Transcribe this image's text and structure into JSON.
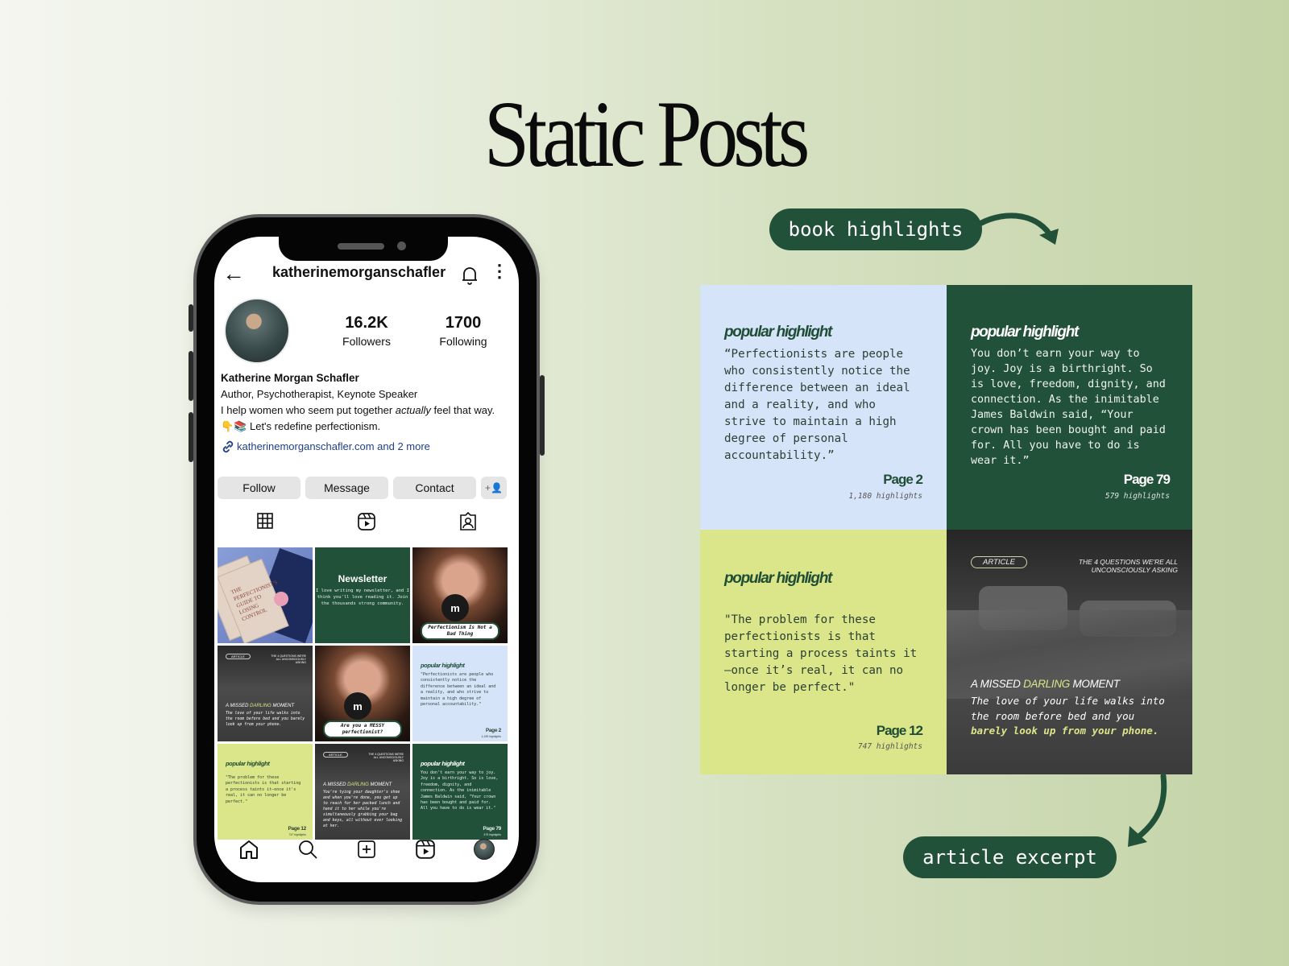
{
  "page": {
    "title": "Static Posts",
    "colors": {
      "brand_green": "#22513a",
      "light_blue": "#d6e4fa",
      "lime": "#dbe589",
      "charcoal": "#3d3d3d",
      "background_start": "#f4f6ef",
      "background_end": "#c3d3a6"
    }
  },
  "phone": {
    "header": {
      "back_icon": "arrow-left-icon",
      "username": "katherinemorganschafler",
      "bell_icon": "bell-icon",
      "more_icon": "more-vertical-icon"
    },
    "stats": [
      {
        "value": "16.2K",
        "label": "Followers"
      },
      {
        "value": "1700",
        "label": "Following"
      }
    ],
    "bio": {
      "name": "Katherine Morgan Schafler",
      "line1": "Author, Psychotherapist, Keynote Speaker",
      "line2_pre": "I help women who seem put together ",
      "line2_em": "actually",
      "line2_post": " feel that way.",
      "line3_emoji": "👇📚",
      "line3": " Let's redefine perfectionism.",
      "link": "katherinemorganschafler.com and 2 more"
    },
    "actions": {
      "follow": "Follow",
      "message": "Message",
      "contact": "Contact",
      "add_user_icon": "+👤"
    },
    "tabs": [
      "grid-icon",
      "reels-icon",
      "tagged-icon"
    ],
    "grid": {
      "book": {
        "lines": "THE PERFECTIONIST'S GUIDE TO LOSING CONTROL"
      },
      "newsletter": {
        "title": "Newsletter",
        "text": "I love writing my newsletter, and I think you'll love reading it. Join the thousands strong community."
      },
      "podcast1": {
        "mic_letter": "m",
        "caption": "Perfectionism Is Not a Bad Thing"
      },
      "article1": {
        "pill": "ARTICLE",
        "questions": "THE 4 QUESTIONS WE'RE ALL UNCONSCIOUSLY ASKING",
        "heading_pre": "A MISSED ",
        "heading_hl": "DARLING",
        "heading_post": " MOMENT",
        "text": "The love of your life walks into the room before bed and you barely look up from your phone."
      },
      "podcast2": {
        "mic_letter": "m",
        "caption": "Are you a MESSY perfectionist?"
      },
      "highlight_blue": {
        "label": "popular highlight",
        "quote": "\"Perfectionists are people who consistently notice the difference between an ideal and a reality, and who strive to maintain a high degree of personal accountability.\"",
        "page": "Page 2",
        "count": "1,180 highlights"
      },
      "highlight_lime": {
        "label": "popular highlight",
        "quote": "\"The problem for these perfectionists is that starting a process taints it—once it's real, it can no longer be perfect.\"",
        "page": "Page 12",
        "count": "747 highlights"
      },
      "article2": {
        "pill": "ARTICLE",
        "questions": "THE 4 QUESTIONS WE'RE ALL UNCONSCIOUSLY ASKING",
        "heading_pre": "A MISSED ",
        "heading_hl": "DARLING",
        "heading_post": " MOMENT",
        "text": "You're tying your daughter's shoe and when you're done, you get up to reach for her packed lunch and hand it to her while you're simultaneously grabbing your bag and keys, all without ever looking at her."
      },
      "highlight_dark": {
        "label": "popular highlight",
        "quote": "You don't earn your way to joy. Joy is a birthright. So is love, freedom, dignity, and connection. As the inimitable James Baldwin said, \"Your crown has been bought and paid for. All you have to do is wear it.\"",
        "page": "Page 79",
        "count": "579 highlights"
      }
    },
    "bottom_nav": [
      "home-icon",
      "search-icon",
      "create-icon",
      "reels-icon",
      "profile-avatar"
    ]
  },
  "labels": {
    "book_highlights": "book highlights",
    "article_excerpt": "article excerpt"
  },
  "posts": {
    "blue": {
      "label": "popular highlight",
      "quote": "“Perfectionists are people who consistently notice the difference between an ideal and a reality, and who strive to maintain a high degree of personal accountability.”",
      "page": "Page 2",
      "count": "1,180 highlights"
    },
    "dark": {
      "label": "popular highlight",
      "quote": "You don’t earn your way to joy. Joy is a birthright. So is love, freedom, dignity, and connection. As the inimitable James Baldwin said, “Your crown has been bought and paid for. All you have to do is wear it.”",
      "page": "Page 79",
      "count": "579 highlights"
    },
    "lime": {
      "label": "popular highlight",
      "quote": "\"The problem for these perfectionists is that starting a process taints it—once it’s real, it can no longer be perfect.\"",
      "page": "Page 12",
      "count": "747 highlights"
    },
    "article": {
      "pill": "ARTICLE",
      "questions": "THE 4 QUESTIONS WE'RE ALL UNCONSCIOUSLY ASKING",
      "heading_pre": "A MISSED ",
      "heading_hl": "DARLING",
      "heading_post": " MOMENT",
      "text_pre": "The love of your life walks into the room before bed and you ",
      "text_bold": "barely look up from your phone."
    }
  }
}
